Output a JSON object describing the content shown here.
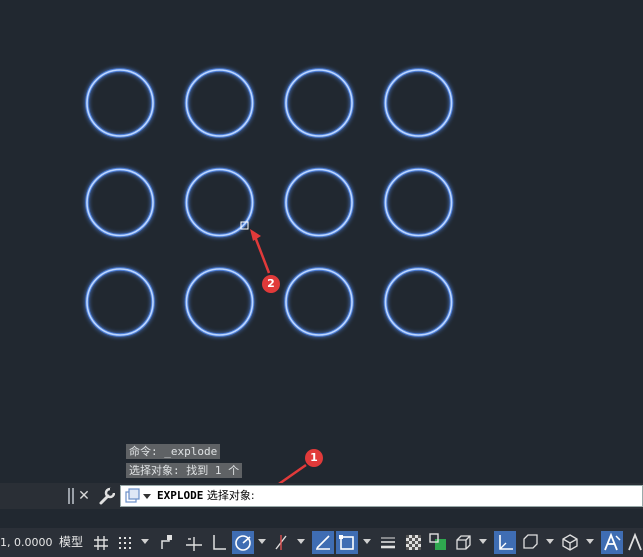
{
  "drawing": {
    "circle_color": "#bcd6ff",
    "glow_color": "#4e7fd8",
    "rows": 3,
    "cols": 4
  },
  "command_history": [
    "命令: _explode",
    "选择对象: 找到 1 个"
  ],
  "command_line": {
    "command": "EXPLODE",
    "prompt": " 选择对象:"
  },
  "status_bar": {
    "coordinates": "1, 0.0000",
    "model_tab": "模型",
    "active_color": "#3f6db3"
  },
  "annotations": {
    "marker_1": "1",
    "marker_2": "2",
    "color": "#e13a3a"
  }
}
